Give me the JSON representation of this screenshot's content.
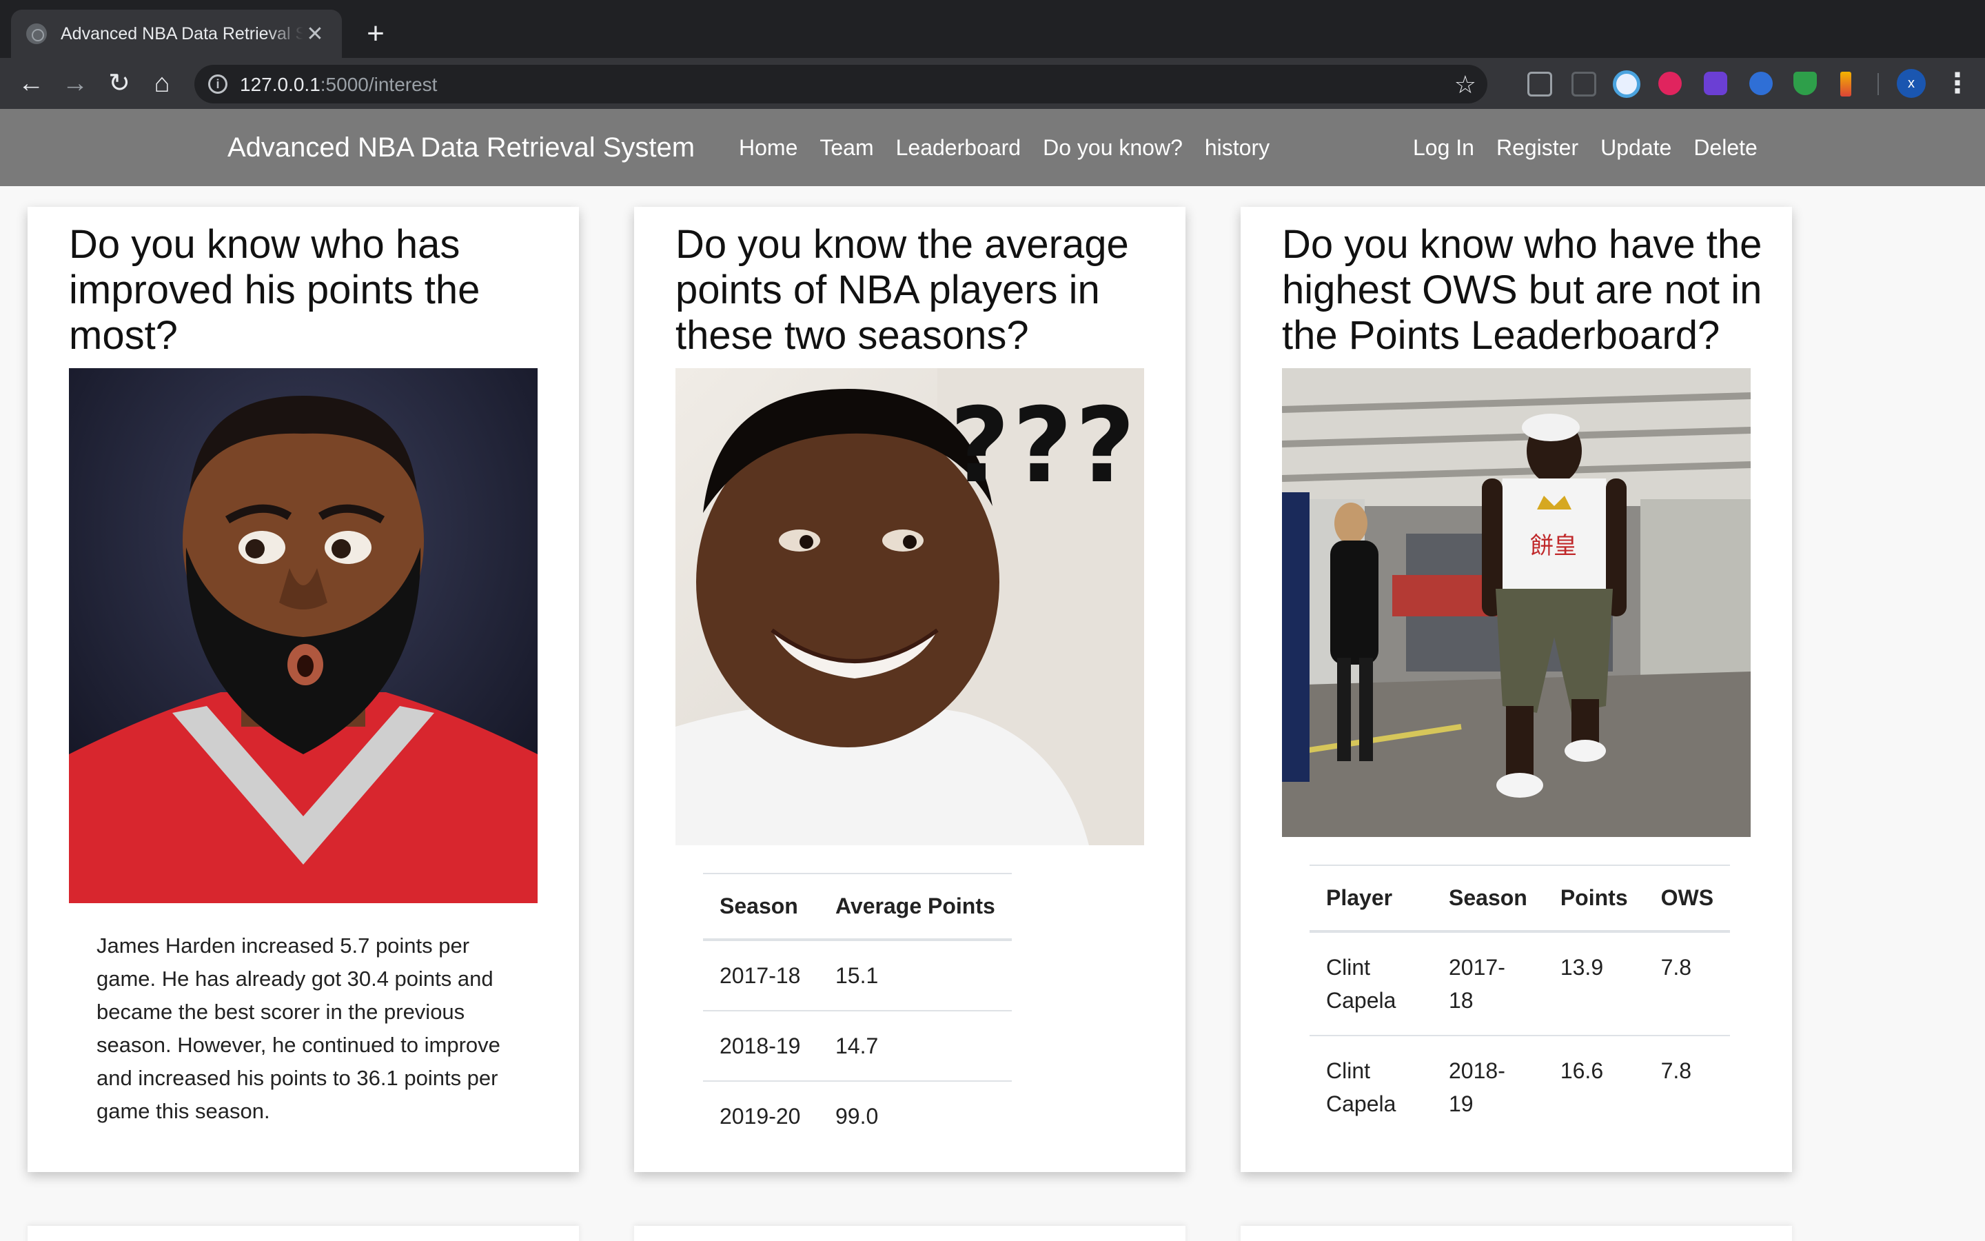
{
  "browser": {
    "tab_title": "Advanced NBA Data Retrieval System",
    "tab_close": "✕",
    "new_tab": "+",
    "url_host": "127.0.0.1",
    "url_rest": ":5000/interest"
  },
  "nav": {
    "brand": "Advanced NBA Data Retrieval System",
    "links": [
      "Home",
      "Team",
      "Leaderboard",
      "Do you know?",
      "history"
    ],
    "auth": [
      "Log In",
      "Register",
      "Update",
      "Delete"
    ]
  },
  "cards": [
    {
      "title": "Do you know who has improved his points the most?",
      "text": "James Harden increased 5.7 points per game. He has already got 30.4 points and became the best scorer in the previous season. However, he continued to improve and increased his points to 36.1 points per game this season."
    },
    {
      "title": "Do you know the average points of NBA players in these two seasons?",
      "image_text": "???",
      "table": {
        "headers": [
          "Season",
          "Average Points"
        ],
        "rows": [
          [
            "2017-18",
            "15.1"
          ],
          [
            "2018-19",
            "14.7"
          ],
          [
            "2019-20",
            "99.0"
          ]
        ]
      }
    },
    {
      "title": "Do you know who have the highest OWS but are not in the Points Leaderboard?",
      "image_text": "餅皇",
      "table": {
        "headers": [
          "Player",
          "Season",
          "Points",
          "OWS"
        ],
        "rows": [
          [
            "Clint Capela",
            "2017-18",
            "13.9",
            "7.8"
          ],
          [
            "Clint Capela",
            "2018-19",
            "16.6",
            "7.8"
          ]
        ]
      }
    }
  ]
}
